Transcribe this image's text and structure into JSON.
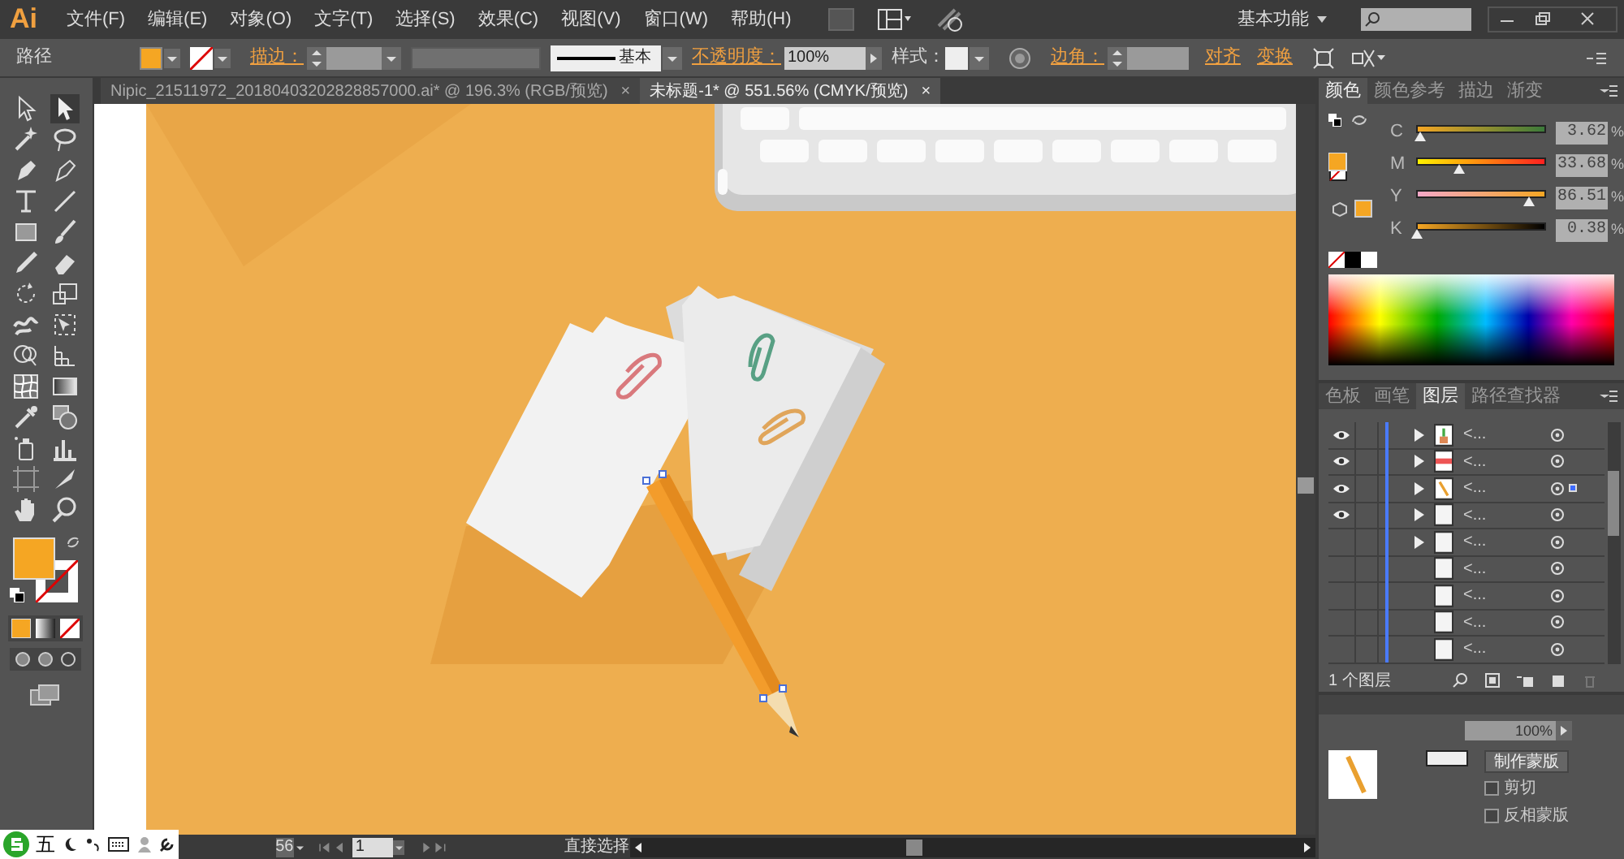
{
  "menu_bar": {
    "logo": "Ai",
    "items": [
      "文件(F)",
      "编辑(E)",
      "对象(O)",
      "文字(T)",
      "选择(S)",
      "效果(C)",
      "视图(V)",
      "窗口(W)",
      "帮助(H)"
    ],
    "workspace": "基本功能"
  },
  "control_bar": {
    "label": "路径",
    "stroke_label": "描边：",
    "profile": "基本",
    "opacity_label": "不透明度：",
    "opacity": "100%",
    "style_label": "样式：",
    "corner_label": "边角：",
    "align": "对齐",
    "transform": "变换"
  },
  "doc_tabs": [
    {
      "title": "Nipic_21511972_20180403202828857000.ai* @ 196.3% (RGB/预览)",
      "close": "×",
      "selected": false
    },
    {
      "title": "未标题-1* @ 551.56% (CMYK/预览)",
      "close": "×",
      "selected": true
    }
  ],
  "color_panel": {
    "tabs": [
      {
        "label": "颜色",
        "selected": true
      },
      {
        "label": "颜色参考",
        "selected": false
      },
      {
        "label": "描边",
        "selected": false
      },
      {
        "label": "渐变",
        "selected": false
      }
    ],
    "sliders": [
      {
        "channel": "C",
        "level": 0.036,
        "value": "3.62",
        "unit": "%"
      },
      {
        "channel": "M",
        "level": 0.337,
        "value": "33.68",
        "unit": "%"
      },
      {
        "channel": "Y",
        "level": 0.865,
        "value": "86.51",
        "unit": "%"
      },
      {
        "channel": "K",
        "level": 0.004,
        "value": "0.38",
        "unit": "%"
      }
    ]
  },
  "layers_panel": {
    "tabs": [
      {
        "label": "色板",
        "selected": false
      },
      {
        "label": "画笔",
        "selected": false
      },
      {
        "label": "图层",
        "selected": true
      },
      {
        "label": "路径查找器",
        "selected": false
      }
    ],
    "rows": [
      {
        "name": "<...",
        "visible": true,
        "expandable": true,
        "selected": false
      },
      {
        "name": "<...",
        "visible": true,
        "expandable": true,
        "selected": false
      },
      {
        "name": "<...",
        "visible": true,
        "expandable": true,
        "selected": true
      },
      {
        "name": "<...",
        "visible": true,
        "expandable": true,
        "selected": false
      },
      {
        "name": "<...",
        "visible": false,
        "expandable": true,
        "selected": false
      },
      {
        "name": "<...",
        "visible": false,
        "expandable": false,
        "selected": false
      },
      {
        "name": "<...",
        "visible": false,
        "expandable": false,
        "selected": false
      },
      {
        "name": "<...",
        "visible": false,
        "expandable": false,
        "selected": false
      },
      {
        "name": "<...",
        "visible": false,
        "expandable": false,
        "selected": false
      }
    ],
    "footer": "1 个图层"
  },
  "transparency_panel": {
    "opacity": "100%",
    "make_mask": "制作蒙版",
    "options": [
      {
        "label": "剪切",
        "checked": false
      },
      {
        "label": "反相蒙版",
        "checked": false
      }
    ]
  },
  "status_bar": {
    "zoom": "56",
    "artboard": "1",
    "tool": "直接选择"
  },
  "ime_bar": {
    "mode": "五"
  }
}
